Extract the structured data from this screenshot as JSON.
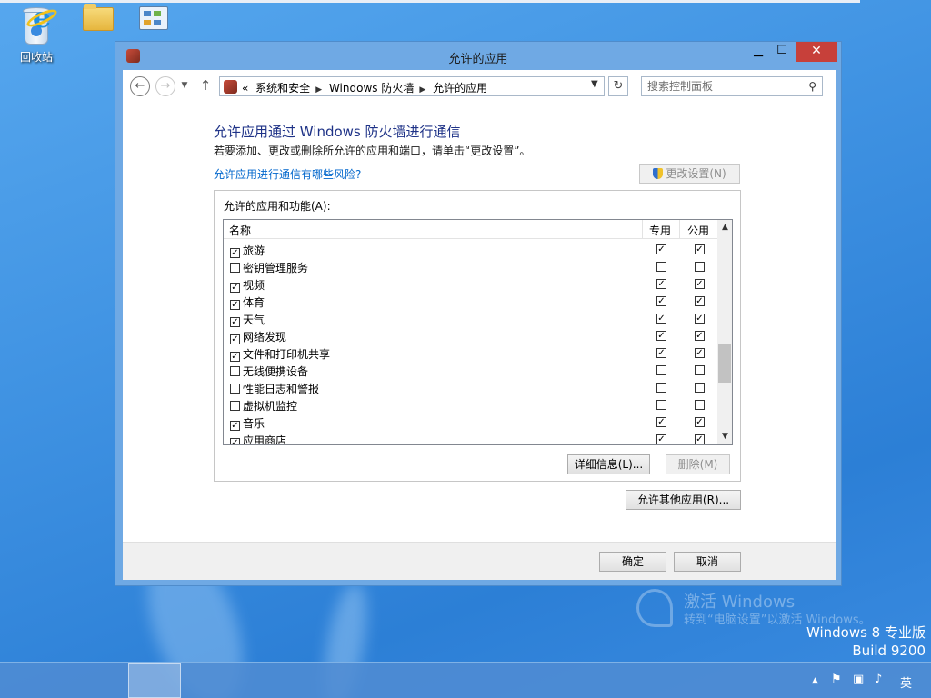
{
  "desktop": {
    "recycle_bin_label": "回收站"
  },
  "window": {
    "title": "允许的应用",
    "address": {
      "overflow": "«",
      "crumbs": [
        "系统和安全",
        "Windows 防火墙",
        "允许的应用"
      ]
    },
    "search_placeholder": "搜索控制面板",
    "heading": "允许应用通过 Windows 防火墙进行通信",
    "description": "若要添加、更改或删除所允许的应用和端口，请单击“更改设置”。",
    "risk_link": "允许应用进行通信有哪些风险?",
    "change_settings": "更改设置(N)",
    "group_label": "允许的应用和功能(A):",
    "columns": {
      "name": "名称",
      "private": "专用",
      "public": "公用"
    },
    "rows": [
      {
        "name": "旅游",
        "checked": "☑",
        "private": "☑",
        "public": "☑"
      },
      {
        "name": "密钥管理服务",
        "checked": "☐",
        "private": "☐",
        "public": "☐"
      },
      {
        "name": "视频",
        "checked": "☑",
        "private": "☑",
        "public": "☑"
      },
      {
        "name": "体育",
        "checked": "☑",
        "private": "☑",
        "public": "☑"
      },
      {
        "name": "天气",
        "checked": "☑",
        "private": "☑",
        "public": "☑"
      },
      {
        "name": "网络发现",
        "checked": "☑",
        "private": "☑",
        "public": "☑"
      },
      {
        "name": "文件和打印机共享",
        "checked": "☑",
        "private": "☑",
        "public": "☑"
      },
      {
        "name": "无线便携设备",
        "checked": "☐",
        "private": "☐",
        "public": "☐"
      },
      {
        "name": "性能日志和警报",
        "checked": "☐",
        "private": "☐",
        "public": "☐"
      },
      {
        "name": "虚拟机监控",
        "checked": "☐",
        "private": "☐",
        "public": "☐"
      },
      {
        "name": "音乐",
        "checked": "☑",
        "private": "☑",
        "public": "☑"
      },
      {
        "name": "应用商店",
        "checked": "☑",
        "private": "☑",
        "public": "☑"
      }
    ],
    "details_button": "详细信息(L)...",
    "delete_button": "删除(M)",
    "allow_other_button": "允许其他应用(R)...",
    "ok_button": "确定",
    "cancel_button": "取消"
  },
  "watermark": {
    "line1": "激活 Windows",
    "line2": "转到“电脑设置”以激活 Windows。"
  },
  "os_info": {
    "edition": "Windows 8 专业版",
    "build": "Build 9200"
  },
  "tray": {
    "ime": "英"
  },
  "colors": {
    "accent_link": "#0066cc",
    "heading": "#1e3287",
    "close_button": "#c7403a"
  }
}
